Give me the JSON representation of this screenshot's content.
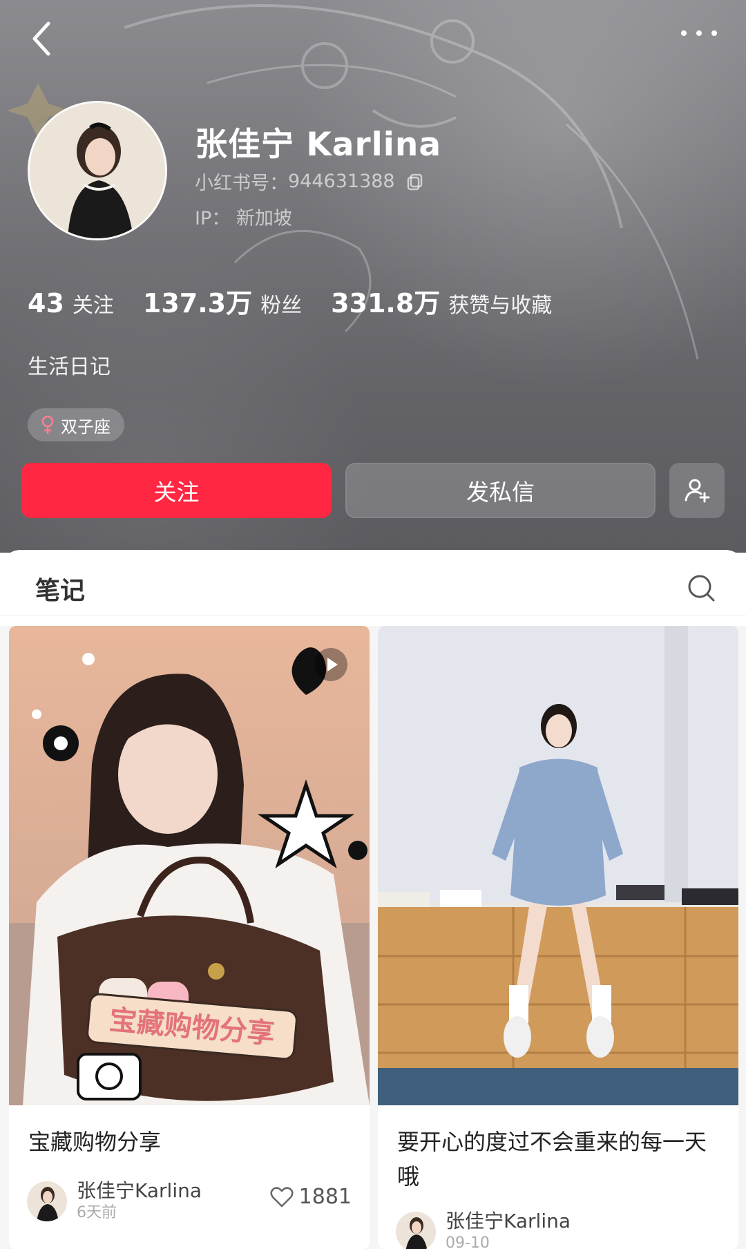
{
  "profile": {
    "name": "张佳宁 Karlina",
    "id_label": "小红书号：",
    "id_value": "944631388",
    "ip_label": "IP：",
    "ip_value": "新加坡",
    "bio": "生活日记",
    "tag": "双子座"
  },
  "stats": [
    {
      "num": "43",
      "label": "关注"
    },
    {
      "num": "137.3万",
      "label": "粉丝"
    },
    {
      "num": "331.8万",
      "label": "获赞与收藏"
    }
  ],
  "actions": {
    "follow": "关注",
    "message": "发私信"
  },
  "tabs": {
    "notes": "笔记"
  },
  "notes": [
    {
      "title": "宝藏购物分享",
      "overlay_text": "宝藏购物分享",
      "author": "张佳宁Karlina",
      "time": "6天前",
      "likes": "1881",
      "is_video": true
    },
    {
      "title": "要开心的度过不会重来的每一天哦",
      "author": "张佳宁Karlina",
      "time": "09-10",
      "is_video": false
    }
  ],
  "icons": [
    "back-icon",
    "more-icon",
    "copy-icon",
    "female-icon",
    "add-user-icon",
    "search-icon",
    "heart-icon",
    "play-icon"
  ],
  "colors": {
    "accent": "#ff2741",
    "header_bg": "#6e6d72"
  }
}
